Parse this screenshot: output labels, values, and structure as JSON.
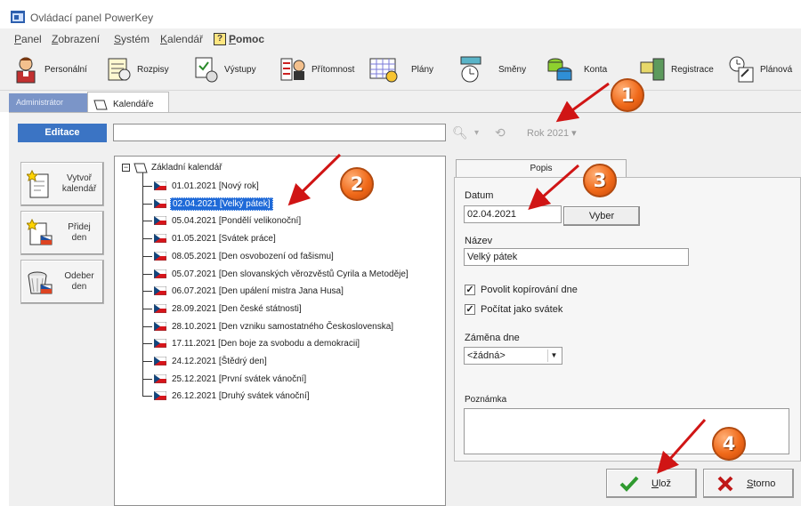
{
  "window": {
    "title": "Ovládací panel PowerKey"
  },
  "menu": [
    {
      "label": "Panel",
      "u": "P",
      "rest": "anel"
    },
    {
      "label": "Zobrazení",
      "u": "Z",
      "rest": "obrazení"
    },
    {
      "label": "Systém",
      "u": "S",
      "rest": "ystém"
    },
    {
      "label": "Kalendář",
      "u": "K",
      "rest": "alendář"
    },
    {
      "label": "Pomoc",
      "u": "P",
      "rest": "omoc"
    }
  ],
  "toolbar": [
    {
      "label": "Personální",
      "icon": "person-icon"
    },
    {
      "label": "Rozpisy",
      "icon": "schedule-icon"
    },
    {
      "label": "Výstupy",
      "icon": "output-icon"
    },
    {
      "label": "Přítomnost",
      "icon": "attendance-icon"
    },
    {
      "label": "Plány",
      "icon": "plan-icon"
    },
    {
      "label": "Směny",
      "icon": "shift-icon"
    },
    {
      "label": "Konta",
      "icon": "accounts-icon"
    },
    {
      "label": "Registrace",
      "icon": "registration-icon"
    },
    {
      "label": "Plánová",
      "icon": "planner-icon"
    }
  ],
  "tabs": {
    "admin": "Administrátor",
    "calendar": "Kalendáře"
  },
  "editace_label": "Editace",
  "year_label": "Rok 2021",
  "side_buttons": [
    {
      "label_line1": "Vytvoř",
      "label_line2": "kalendář"
    },
    {
      "label_line1": "Přidej",
      "label_line2": "den"
    },
    {
      "label_line1": "Odeber",
      "label_line2": "den"
    }
  ],
  "tree": {
    "root": "Základní kalendář",
    "items": [
      "01.01.2021 [Nový rok]",
      "02.04.2021 [Velký pátek]",
      "05.04.2021 [Pondělí velikonoční]",
      "01.05.2021 [Svátek práce]",
      "08.05.2021 [Den osvobození od fašismu]",
      "05.07.2021 [Den slovanských věrozvěstů Cyrila a Metoděje]",
      "06.07.2021 [Den upálení mistra Jana Husa]",
      "28.09.2021 [Den české státnosti]",
      "28.10.2021 [Den vzniku samostatného Československa]",
      "17.11.2021 [Den boje za svobodu a demokracii]",
      "24.12.2021 [Štědrý den]",
      "25.12.2021 [První svátek vánoční]",
      "26.12.2021 [Druhý svátek vánoční]"
    ],
    "selected_index": 1
  },
  "details": {
    "tab": "Popis",
    "datum_label": "Datum",
    "datum_value": "02.04.2021",
    "vyber_label": "Vyber",
    "nazev_label": "Název",
    "nazev_value": "Velký pátek",
    "chk1_label": "Povolit kopírování dne",
    "chk2_label": "Počítat jako svátek",
    "zamena_label": "Záměna dne",
    "zamena_value": "<žádná>",
    "poznamka_label": "Poznámka"
  },
  "buttons": {
    "save": "Ulož",
    "save_u": "U",
    "save_rest": "lož",
    "cancel": "Storno",
    "cancel_u": "S",
    "cancel_rest": "torno"
  },
  "callouts": [
    "1",
    "2",
    "3",
    "4"
  ],
  "colors": {
    "accent": "#3b74c4",
    "selection": "#1f6ad8",
    "callout": "#f06a1a",
    "arrow": "#d01515"
  }
}
